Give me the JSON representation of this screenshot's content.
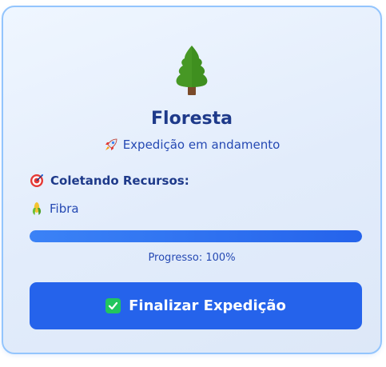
{
  "card": {
    "title": "Floresta",
    "status_text": "Expedição em andamento",
    "collect_label": "Coletando Recursos:",
    "resource_name": "Fibra",
    "progress_fraction": 1.0,
    "progress_text": "Progresso: 100%",
    "finish_button_label": "Finalizar Expedição"
  },
  "icons": {
    "main": "evergreen-tree-icon",
    "status": "rocket-icon",
    "collect": "target-icon",
    "resource": "corn-icon",
    "button": "check-mark-icon"
  },
  "colors": {
    "accent": "#2563eb",
    "title": "#1e3a8a",
    "text": "#2549b3",
    "border": "#93c5fd",
    "check": "#22c55e"
  }
}
